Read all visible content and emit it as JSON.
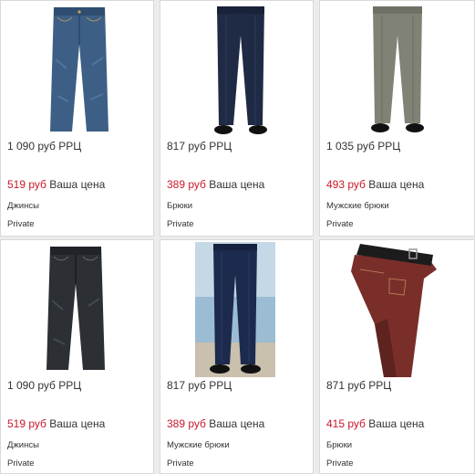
{
  "products": [
    {
      "name": "Джинсы",
      "rrc_price": "1 090 руб РРЦ",
      "sale_price": "519 руб",
      "price_label": "Ваша цена",
      "brand": "Private",
      "image_icon": "blue-jeans-icon"
    },
    {
      "name": "Брюки",
      "rrc_price": "817 руб РРЦ",
      "sale_price": "389 руб",
      "price_label": "Ваша цена",
      "brand": "Private",
      "image_icon": "navy-trousers-icon"
    },
    {
      "name": "Мужские брюки",
      "rrc_price": "1 035 руб РРЦ",
      "sale_price": "493 руб",
      "price_label": "Ваша цена",
      "brand": "Private",
      "image_icon": "olive-trousers-icon"
    },
    {
      "name": "Джинсы",
      "rrc_price": "1 090 руб РРЦ",
      "sale_price": "519 руб",
      "price_label": "Ваша цена",
      "brand": "Private",
      "image_icon": "black-jeans-icon"
    },
    {
      "name": "Мужские брюки",
      "rrc_price": "817 руб РРЦ",
      "sale_price": "389 руб",
      "price_label": "Ваша цена",
      "brand": "Private",
      "image_icon": "navy-trousers-model-icon"
    },
    {
      "name": "Брюки",
      "rrc_price": "871 руб РРЦ",
      "sale_price": "415 руб",
      "price_label": "Ваша цена",
      "brand": "Private",
      "image_icon": "burgundy-trousers-belt-icon"
    }
  ],
  "colors": {
    "sale_price": "#c8182b",
    "text": "#333333",
    "card_background": "#ffffff",
    "page_background": "#ececec"
  }
}
